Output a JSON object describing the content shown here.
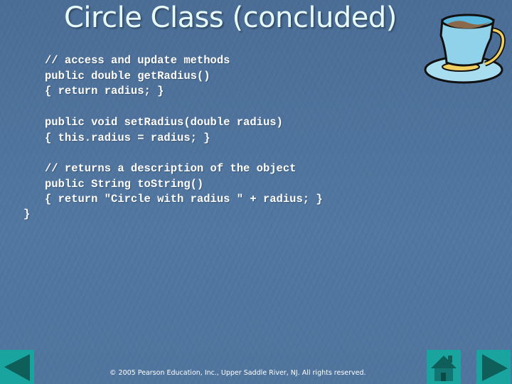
{
  "slide": {
    "title": "Circle Class (concluded)",
    "code_block_1": "// access and update methods\npublic double getRadius()\n{ return radius; }",
    "code_block_2": "public void setRadius(double radius)\n{ this.radius = radius; }",
    "code_block_3": "// returns a description of the object\npublic String toString()\n{ return \"Circle with radius \" + radius; }",
    "closing_brace": "}",
    "footer": "© 2005 Pearson Education, Inc., Upper Saddle River, NJ.  All rights reserved."
  },
  "decoration": {
    "icon": "coffee-cup-icon"
  },
  "navigation": {
    "prev_icon": "left-arrow-icon",
    "home_icon": "home-icon",
    "next_icon": "right-arrow-icon",
    "button_color": "#1aa49f",
    "glyph_color": "#0e5e5a"
  },
  "theme": {
    "background": "#4d6f97",
    "title_color": "#e8fbfb",
    "text_color": "#ffffff"
  }
}
